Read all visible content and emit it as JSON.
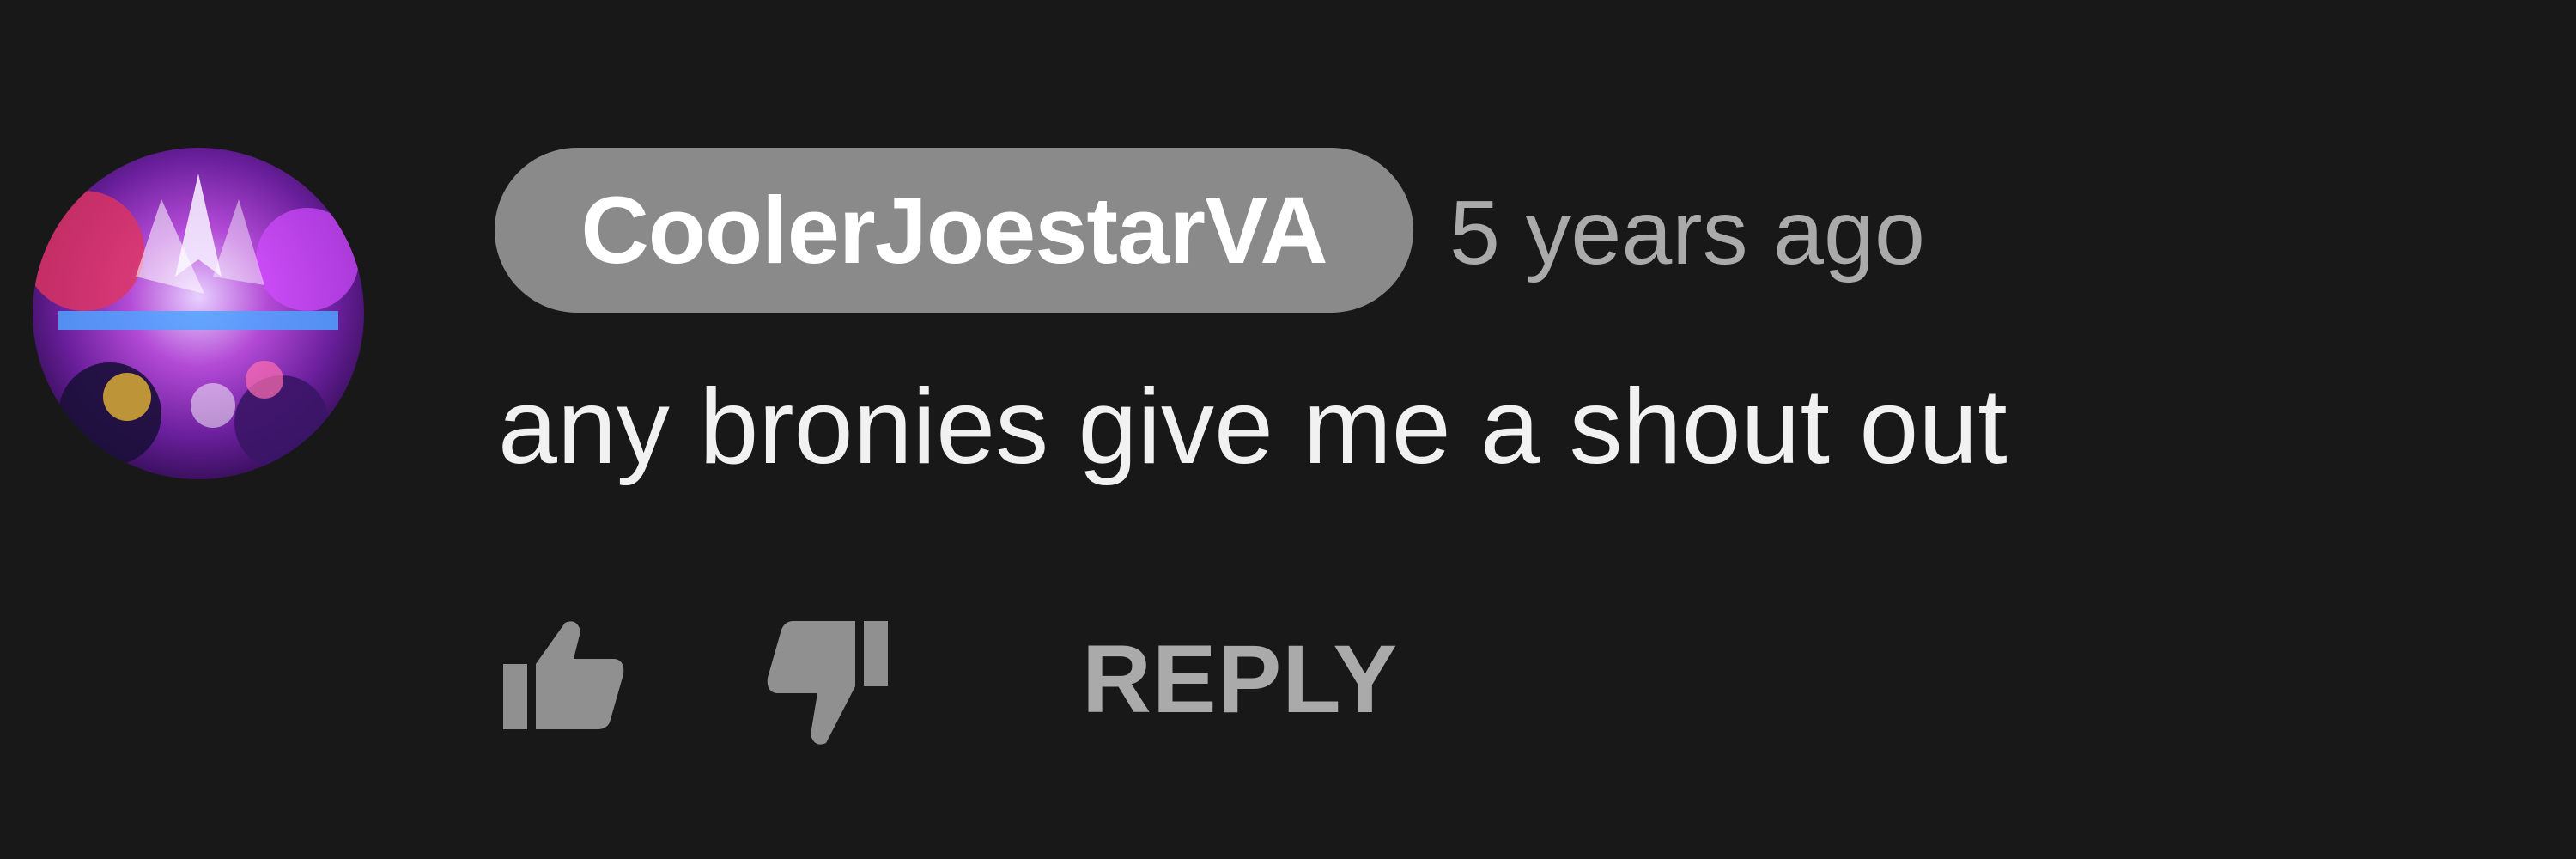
{
  "comment": {
    "avatar_icon": "avatar-image",
    "author": "CoolerJoestarVA",
    "timestamp": "5 years ago",
    "text": "any bronies give me a shout out"
  },
  "actions": {
    "like_icon": "thumbs-up-icon",
    "dislike_icon": "thumbs-down-icon",
    "reply_label": "REPLY"
  },
  "colors": {
    "background": "#181818",
    "badge": "#8a8a8a",
    "secondary_text": "#aaaaaa",
    "primary_text": "#f1f1f1"
  }
}
